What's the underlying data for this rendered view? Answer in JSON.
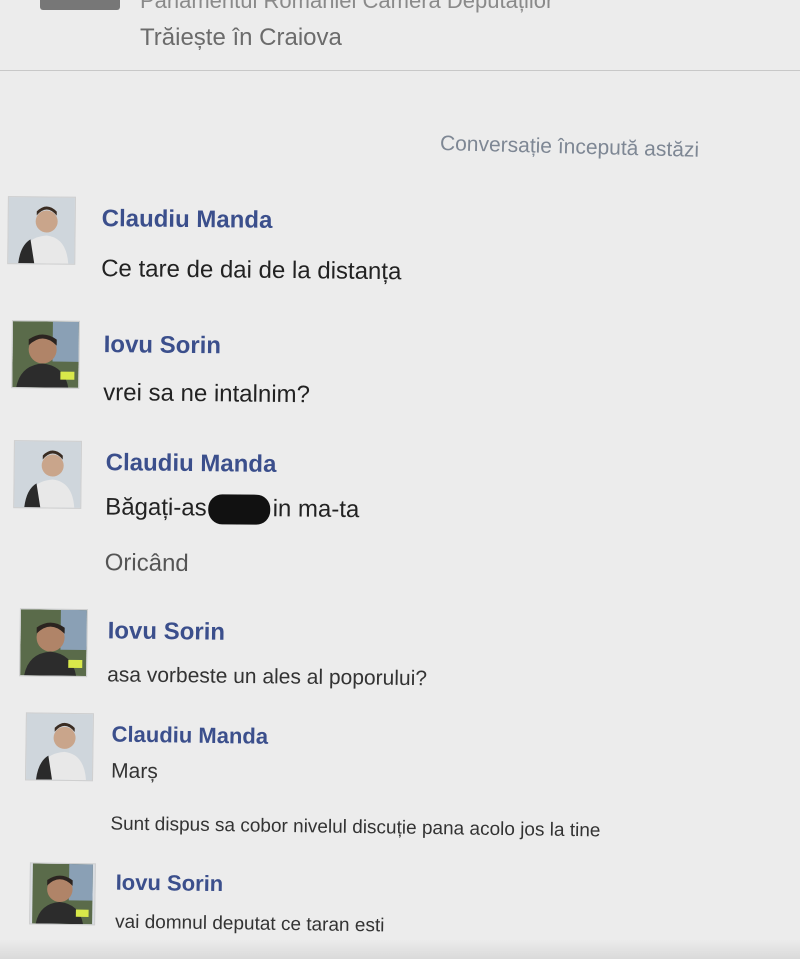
{
  "header": {
    "title": "Parlamentul României Camera Deputaților",
    "location": "Trăiește în Craiova"
  },
  "conversation_started": "Conversație începută astăzi",
  "messages": [
    {
      "sender": "Claudiu Manda",
      "avatar_icon": "profile-photo-icon",
      "texts": [
        "Ce tare de dai de la distanța"
      ]
    },
    {
      "sender": "Iovu Sorin",
      "avatar_icon": "profile-photo-icon",
      "texts": [
        "vrei sa ne intalnim?"
      ]
    },
    {
      "sender": "Claudiu Manda",
      "avatar_icon": "profile-photo-icon",
      "texts": [
        "Băgați-as",
        "in ma-ta",
        "Oricând"
      ]
    },
    {
      "sender": "Iovu Sorin",
      "avatar_icon": "profile-photo-icon",
      "texts": [
        "asa vorbeste un ales al poporului?"
      ]
    },
    {
      "sender": "Claudiu Manda",
      "avatar_icon": "profile-photo-icon",
      "texts": [
        "Marș",
        "Sunt dispus sa cobor nivelul discuție pana acolo jos la tine"
      ]
    },
    {
      "sender": "Iovu Sorin",
      "avatar_icon": "profile-photo-icon",
      "texts": [
        "vai domnul deputat ce taran esti"
      ]
    }
  ],
  "colors": {
    "background": "#ececec",
    "sender_name": "#3b4f8c",
    "censor_bar": "#111111"
  }
}
